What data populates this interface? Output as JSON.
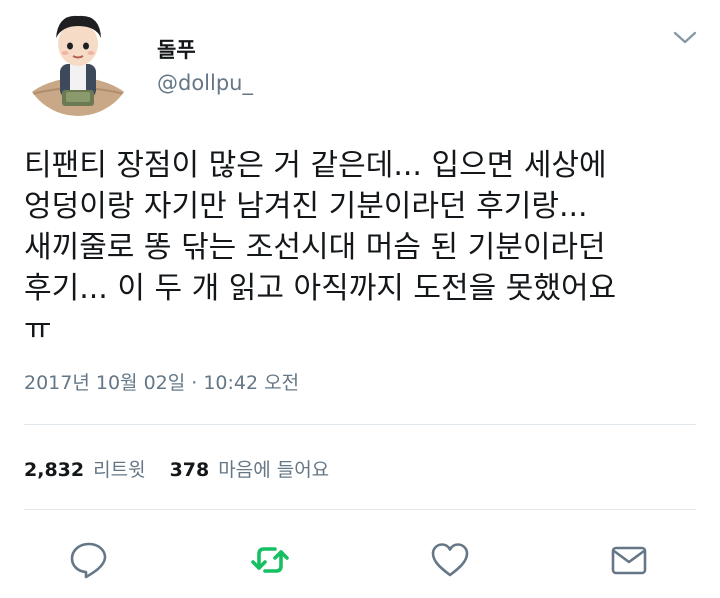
{
  "tweet": {
    "author": {
      "display_name": "돌푸",
      "handle": "@dollpu_",
      "avatar_icon": "cartoon-character-avatar"
    },
    "text_lines": [
      "티팬티 장점이 많은 거 같은데... 입으면 세상에",
      "엉덩이랑 자기만 남겨진 기분이라던 후기랑...",
      "새끼줄로 똥 닦는 조선시대 머슴 된 기분이라던",
      "후기... 이 두 개 읽고 아직까지 도전을 못했어요",
      "ㅠ"
    ],
    "timestamp": "2017년 10월 02일 · 10:42 오전",
    "stats": {
      "retweets_count": "2,832",
      "retweets_label": "리트윗",
      "likes_count": "378",
      "likes_label": "마음에 들어요"
    }
  },
  "actions": [
    {
      "name": "reply-icon",
      "color": "#657786"
    },
    {
      "name": "retweet-icon",
      "color": "#17bf63"
    },
    {
      "name": "like-icon",
      "color": "#657786"
    },
    {
      "name": "message-icon",
      "color": "#657786"
    }
  ],
  "colors": {
    "text": "#14171a",
    "secondary": "#657786",
    "retweet_active": "#17bf63",
    "divider": "#e1e8ed"
  }
}
